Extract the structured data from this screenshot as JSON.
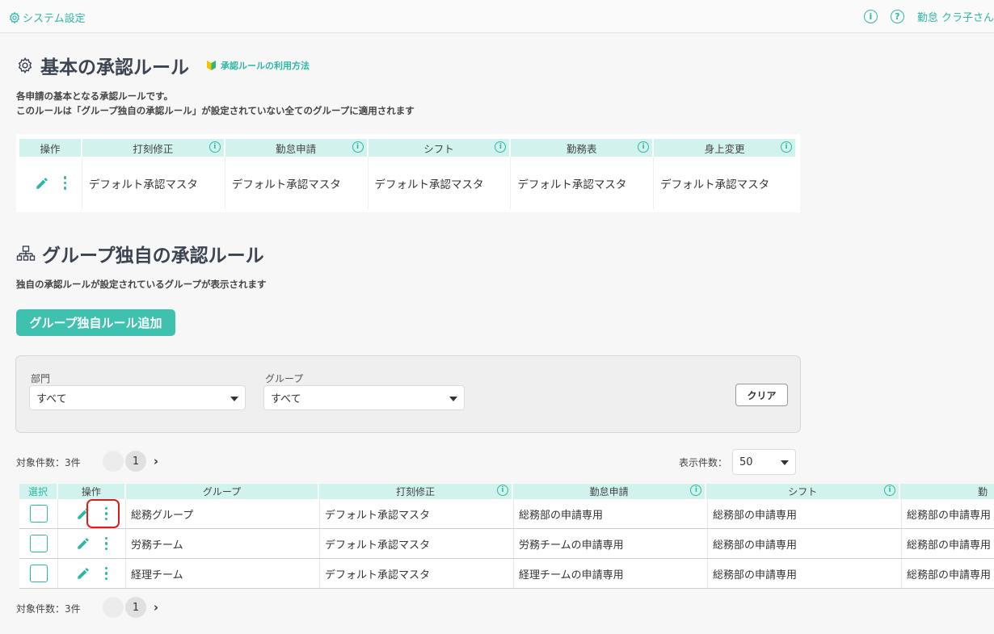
{
  "topbar": {
    "title": "システム設定",
    "user": "勤怠 クラ子さん"
  },
  "basic": {
    "heading": "基本の承認ルール",
    "help_link": "承認ルールの利用方法",
    "desc1": "各申請の基本となる承認ルールです。",
    "desc2": "このルールは「グループ独自の承認ルール」が設定されていない全てのグループに適用されます",
    "headers": [
      "操作",
      "打刻修正",
      "勤怠申請",
      "シフト",
      "勤務表",
      "身上変更"
    ],
    "values": [
      "デフォルト承認マスタ",
      "デフォルト承認マスタ",
      "デフォルト承認マスタ",
      "デフォルト承認マスタ",
      "デフォルト承認マスタ"
    ]
  },
  "group": {
    "heading": "グループ独自の承認ルール",
    "desc": "独自の承認ルールが設定されているグループが表示されます",
    "add_button": "グループ独自ルール追加",
    "filter": {
      "dept_label": "部門",
      "dept_value": "すべて",
      "group_label": "グループ",
      "group_value": "すべて",
      "clear": "クリア"
    },
    "count": "対象件数：3件",
    "page": "1",
    "perpage_label": "表示件数：",
    "perpage_value": "50",
    "headers": [
      "選択",
      "操作",
      "グループ",
      "打刻修正",
      "勤怠申請",
      "シフト",
      "勤"
    ],
    "rows": [
      [
        "総務グループ",
        "デフォルト承認マスタ",
        "総務部の申請専用",
        "総務部の申請専用",
        "総務部の申請専用"
      ],
      [
        "労務チーム",
        "デフォルト承認マスタ",
        "労務チームの申請専用",
        "総務部の申請専用",
        "総務部の申請専用"
      ],
      [
        "経理チーム",
        "デフォルト承認マスタ",
        "経理チームの申請専用",
        "総務部の申請専用",
        "総務部の申請専用"
      ]
    ]
  },
  "colors": {
    "accent": "#2fb7a6",
    "header_bg": "#d2f2ee",
    "highlight": "#e01b1b"
  }
}
